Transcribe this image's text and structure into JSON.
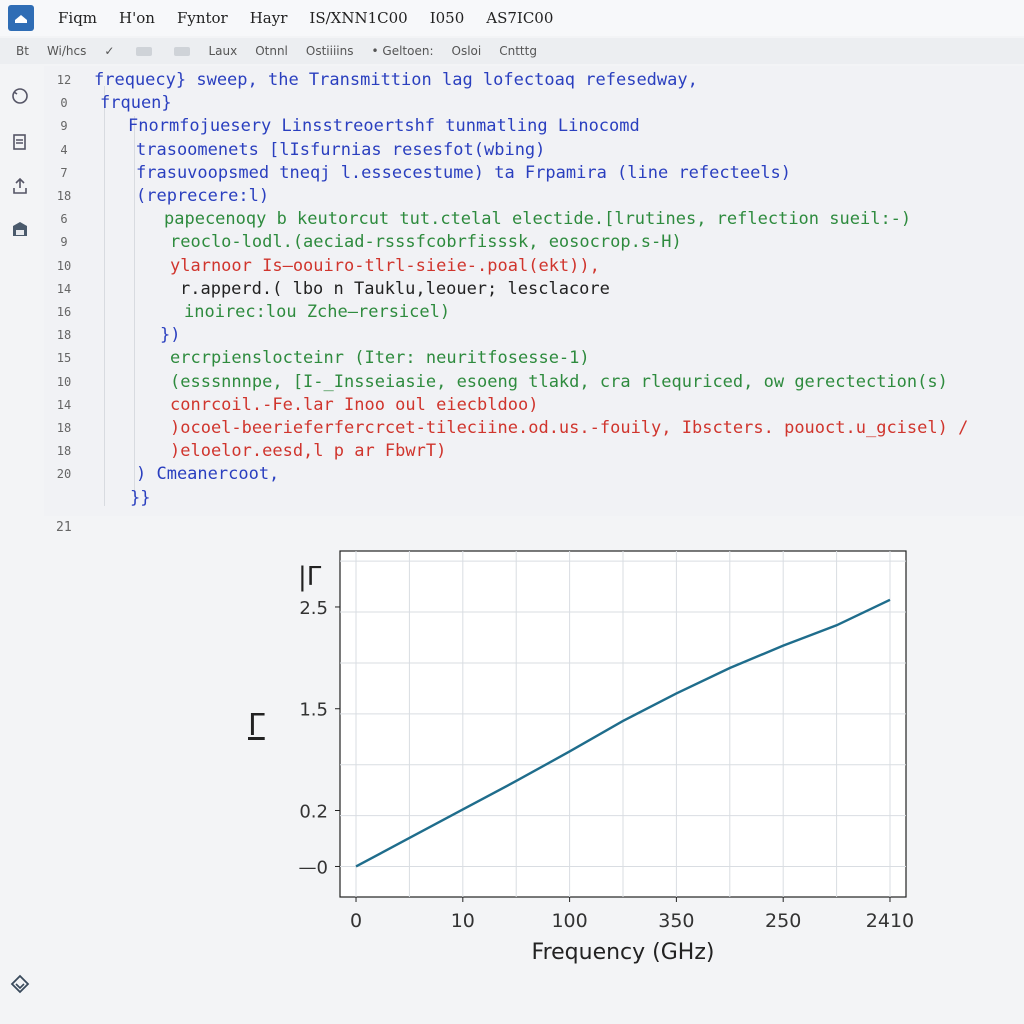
{
  "titlebar": {
    "menu": [
      "Fiqm",
      "H'on",
      "Fyntor",
      "Hayr",
      "IS/XNN1C00",
      "I050",
      "AS7IC00"
    ]
  },
  "toolbar": {
    "items": [
      "Bt",
      "Wi/hcs",
      "✓",
      "Laux",
      "Otnnl",
      "Ostiiiins",
      "• Geltoen:",
      "Osloi",
      "Cntttg"
    ]
  },
  "sidebar": {
    "icons": [
      "refresh-icon",
      "document-icon",
      "upload-icon",
      "save-icon",
      "layers-icon"
    ]
  },
  "editor": {
    "line_numbers": [
      "12",
      "0",
      "9",
      "4",
      "7",
      "18",
      "6",
      "9",
      "10",
      "14",
      "16",
      "18",
      "15",
      "10",
      "14",
      "18",
      "18",
      "20"
    ],
    "last_line_number": "21",
    "lines": [
      {
        "text": "frequecy} sweep, the Transmittion lag lofectoaq refesedway,",
        "color": "mixed"
      },
      {
        "text": "frquen}",
        "color": "blue"
      },
      {
        "text": "Fnormfojuesery Linsstreoertshf tunmatling Linocomd",
        "color": "blue"
      },
      {
        "text": "trasoomenets [lIsfurnias resesfot(wbing)",
        "color": "blue"
      },
      {
        "text": "frasuvoopsmed tneqj l.essecestume) ta Frpamira (line refecteels)",
        "color": "blue"
      },
      {
        "text": "(reprecere:l)",
        "color": "blue"
      },
      {
        "text": "papecenoqy b keutorcut tut.ctelal electide.[lrutines, reflection sueil:-)",
        "color": "green"
      },
      {
        "text": "reoclo-lodl.(aeciad-rsssfcobrfisssk, eosocrop.s-H)",
        "color": "green"
      },
      {
        "text": "ylarnoor Is—oouiro-tlrl-sieie-.poal(ekt)),",
        "color": "red"
      },
      {
        "text": "r.apperd.( lbo n Tauklu,leouer; lesclacore",
        "color": "dark"
      },
      {
        "text": "inoirec:lou Zche—rersicel)",
        "color": "green"
      },
      {
        "text": "})",
        "color": "blue"
      },
      {
        "text": "ercrpienslocteinr (Iter: neuritfosesse-1)",
        "color": "green"
      },
      {
        "text": "(esssnnnpe, [I-_Insseiasie, esoeng tlakd, cra rlequriced, ow gerectection(s)",
        "color": "green"
      },
      {
        "text": "conrcoil.-Fe.lar Inoo oul eiecbldoo)",
        "color": "red"
      },
      {
        "text": ")ocoel-beerieferfercrcet-tileciine.od.us.-fouily, Ibscters. pouoct.u_gcisel) /",
        "color": "red"
      },
      {
        "text": ")eloelor.eesd,l p ar FbwrT)",
        "color": "red"
      },
      {
        "text": ") Cmeanercoot,",
        "color": "blue"
      },
      {
        "text": "}}",
        "color": "blue"
      }
    ]
  },
  "chart_data": {
    "type": "line",
    "xlabel": "Frequency (GHz)",
    "ylabel": "|Γ",
    "ylabel_secondary": "Γ",
    "x_tick_labels": [
      "0",
      "10",
      "100",
      "350",
      "250",
      "2410"
    ],
    "y_tick_labels": [
      "—0",
      "0.2",
      "1.5",
      "2.5"
    ],
    "y_tick_values": [
      0,
      0.2,
      1.5,
      2.5
    ],
    "grid": true,
    "series": [
      {
        "color": "#1f6d8c",
        "x": [
          0,
          0.5,
          1,
          1.5,
          2,
          2.5,
          3,
          3.5,
          4,
          4.5,
          5
        ],
        "y": [
          0.0,
          0.28,
          0.56,
          0.84,
          1.13,
          1.43,
          1.7,
          1.95,
          2.17,
          2.37,
          2.62
        ]
      }
    ],
    "xlim": [
      -0.15,
      5.15
    ],
    "ylim": [
      -0.3,
      3.1
    ]
  }
}
